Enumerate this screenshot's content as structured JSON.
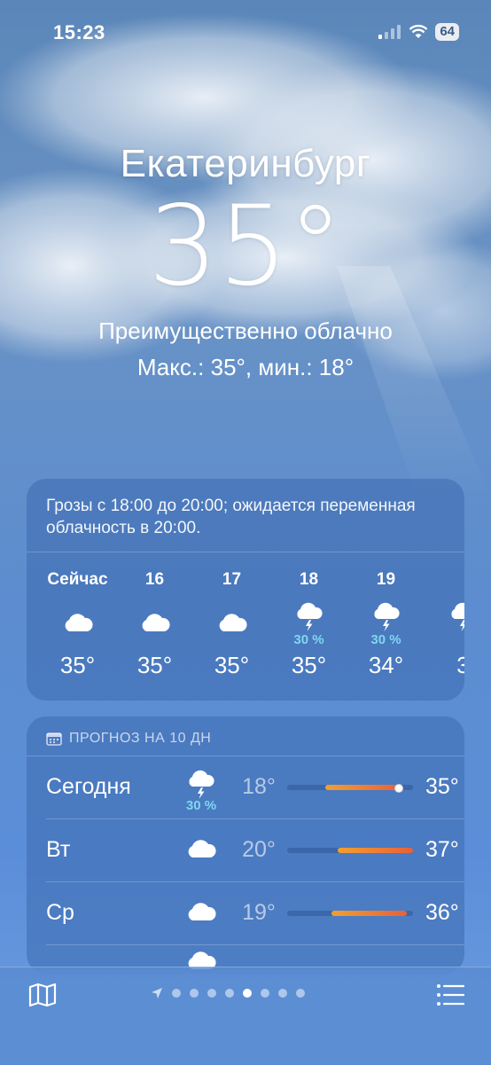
{
  "status_bar": {
    "time": "15:23",
    "battery": "64"
  },
  "location": {
    "city": "Екатеринбург",
    "temperature": "35°",
    "condition": "Преимущественно облачно",
    "high_low": "Макс.: 35°, мин.: 18°"
  },
  "hourly": {
    "summary": "Грозы с 18:00 до 20:00; ожидается переменная облачность в 20:00.",
    "items": [
      {
        "label": "Сейчас",
        "icon": "cloud-icon",
        "precip": "",
        "temp": "35°"
      },
      {
        "label": "16",
        "icon": "cloud-icon",
        "precip": "",
        "temp": "35°"
      },
      {
        "label": "17",
        "icon": "cloud-icon",
        "precip": "",
        "temp": "35°"
      },
      {
        "label": "18",
        "icon": "thunderstorm-icon",
        "precip": "30 %",
        "temp": "35°"
      },
      {
        "label": "19",
        "icon": "thunderstorm-icon",
        "precip": "30 %",
        "temp": "34°"
      },
      {
        "label": "",
        "icon": "thunderstorm-icon",
        "precip": "",
        "temp": "3"
      }
    ]
  },
  "forecast": {
    "header": "ПРОГНОЗ НА 10 ДН",
    "days": [
      {
        "day": "Сегодня",
        "icon": "thunderstorm-icon",
        "precip": "30 %",
        "low": "18°",
        "high": "35°",
        "range_start": 0.3,
        "range_end": 0.9,
        "current": 0.88
      },
      {
        "day": "Вт",
        "icon": "cloud-icon",
        "precip": "",
        "low": "20°",
        "high": "37°",
        "range_start": 0.4,
        "range_end": 1.0
      },
      {
        "day": "Ср",
        "icon": "cloud-icon",
        "precip": "",
        "low": "19°",
        "high": "36°",
        "range_start": 0.35,
        "range_end": 0.95
      }
    ]
  },
  "bottom_bar": {
    "page_count": 8,
    "active_page": 5
  },
  "colors": {
    "precip": "#7fd6f0",
    "bar_warm": "#f0a030",
    "bar_hot": "#e8603a"
  }
}
